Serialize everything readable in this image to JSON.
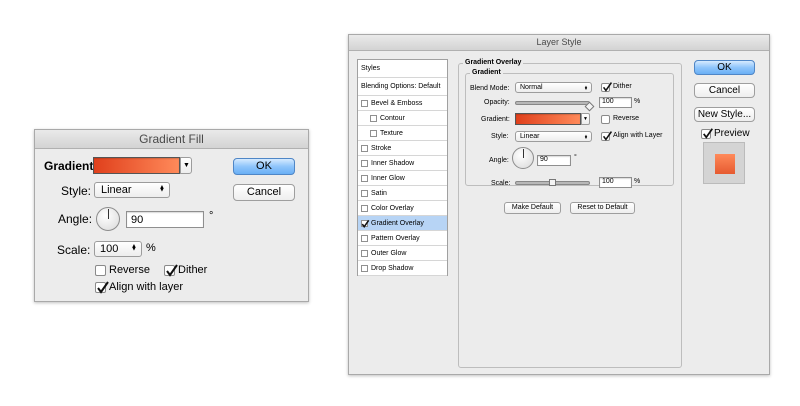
{
  "gradient_fill": {
    "title": "Gradient Fill",
    "gradient_label": "Gradient:",
    "style_label": "Style:",
    "style_value": "Linear",
    "angle_label": "Angle:",
    "angle_value": "90",
    "degree_symbol": "°",
    "scale_label": "Scale:",
    "scale_value": "100",
    "percent_symbol": "%",
    "reverse_label": "Reverse",
    "reverse_checked": false,
    "dither_label": "Dither",
    "dither_checked": true,
    "align_label": "Align with layer",
    "align_checked": true,
    "ok_label": "OK",
    "cancel_label": "Cancel"
  },
  "layer_style": {
    "title": "Layer Style",
    "styles_header": "Styles",
    "blending_options": "Blending Options: Default",
    "style_items": [
      {
        "label": "Bevel & Emboss",
        "checked": false,
        "indent": false
      },
      {
        "label": "Contour",
        "checked": false,
        "indent": true
      },
      {
        "label": "Texture",
        "checked": false,
        "indent": true
      },
      {
        "label": "Stroke",
        "checked": false,
        "indent": false
      },
      {
        "label": "Inner Shadow",
        "checked": false,
        "indent": false
      },
      {
        "label": "Inner Glow",
        "checked": false,
        "indent": false
      },
      {
        "label": "Satin",
        "checked": false,
        "indent": false
      },
      {
        "label": "Color Overlay",
        "checked": false,
        "indent": false
      },
      {
        "label": "Gradient Overlay",
        "checked": true,
        "indent": false,
        "selected": true
      },
      {
        "label": "Pattern Overlay",
        "checked": false,
        "indent": false
      },
      {
        "label": "Outer Glow",
        "checked": false,
        "indent": false
      },
      {
        "label": "Drop Shadow",
        "checked": false,
        "indent": false
      }
    ],
    "panel_title": "Gradient Overlay",
    "group_title": "Gradient",
    "blend_mode_label": "Blend Mode:",
    "blend_mode_value": "Normal",
    "dither_label": "Dither",
    "dither_checked": true,
    "opacity_label": "Opacity:",
    "opacity_value": "100",
    "opacity_level": 1.0,
    "percent_symbol": "%",
    "gradient_label": "Gradient:",
    "reverse_label": "Reverse",
    "reverse_checked": false,
    "style_label": "Style:",
    "style_value": "Linear",
    "align_label": "Align with Layer",
    "align_checked": true,
    "angle_label": "Angle:",
    "angle_value": "90",
    "degree_symbol": "°",
    "scale_label": "Scale:",
    "scale_value": "100",
    "scale_level": 0.5,
    "make_default_label": "Make Default",
    "reset_default_label": "Reset to Default",
    "ok_label": "OK",
    "cancel_label": "Cancel",
    "new_style_label": "New Style...",
    "preview_label": "Preview",
    "preview_checked": true
  },
  "colors": {
    "gradient_start": "#e0401c",
    "gradient_end": "#ff8a5a",
    "selection": "#b7d4f5",
    "default_button": "#6aaff5"
  }
}
